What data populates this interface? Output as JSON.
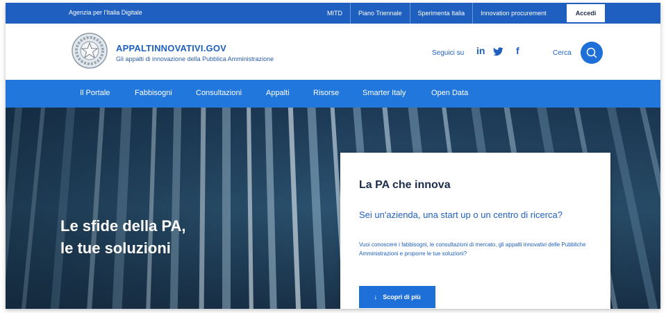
{
  "topbar": {
    "agency": "Agenzia per l'Italia Digitale",
    "links": [
      "MITD",
      "Piano Triennale",
      "Sperimenta Italia",
      "Innovation procurement"
    ],
    "login_label": "Accedi"
  },
  "header": {
    "title": "APPALTINNOVATIVI.GOV",
    "subtitle": "Gli appalti di innovazione della Pubblica Amministrazione",
    "social_label": "Seguici su",
    "social": {
      "linkedin": "in",
      "twitter": "🐦",
      "facebook": "f"
    },
    "search_label": "Cerca",
    "icons": [
      "emblem-icon",
      "linkedin-icon",
      "twitter-icon",
      "facebook-icon",
      "search-icon"
    ]
  },
  "nav": [
    "Il Portale",
    "Fabbisogni",
    "Consultazioni",
    "Appalti",
    "Risorse",
    "Smarter Italy",
    "Open Data"
  ],
  "hero": {
    "line1": "Le sfide della PA,",
    "line2": "le tue soluzioni"
  },
  "card": {
    "title": "La PA che innova",
    "question": "Sei un'azienda, una start up o un centro di ricerca?",
    "description": "Vuoi conoscere i fabbisogni, le consultazioni di mercato, gli appalti innovativi delle Pubbliche Amministrazioni e proporre le tue soluzioni?",
    "button_label": "Scopri di più",
    "button_icon": "arrow-down-icon"
  },
  "colors": {
    "primary": "#1f5fbf",
    "nav": "#2277dd",
    "button": "#1f6fd9",
    "hero_dark": "#23445f"
  }
}
